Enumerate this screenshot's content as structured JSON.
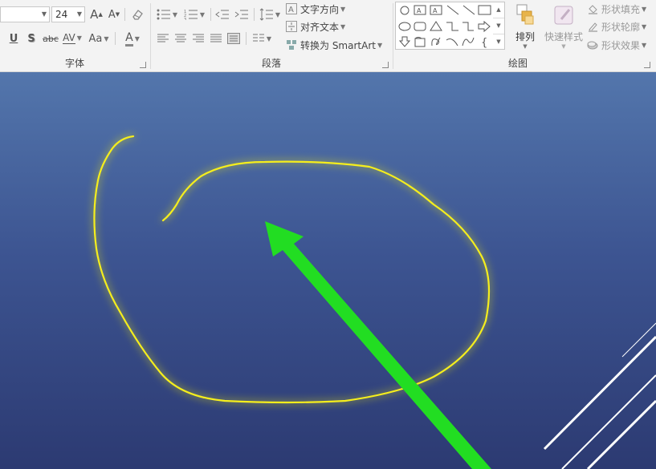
{
  "ribbon": {
    "font_group": {
      "label": "字体",
      "font_name_value": "",
      "font_size_value": "24",
      "grow_font": "A",
      "shrink_font": "A",
      "underline": "U",
      "shadow": "S",
      "strikethrough": "abc",
      "char_spacing": "AV",
      "change_case": "Aa",
      "font_color": "A"
    },
    "paragraph_group": {
      "label": "段落",
      "text_direction": "文字方向",
      "align_text": "对齐文本",
      "convert_smartart": "转换为 SmartArt"
    },
    "drawing_group": {
      "label": "绘图",
      "arrange": "排列",
      "quick_styles": "快速样式",
      "shape_fill": "形状填充",
      "shape_outline": "形状轮廓",
      "shape_effects": "形状效果"
    }
  },
  "colors": {
    "annotation_circle": "#f5ee1e",
    "arrow": "#22dd22",
    "slide_top": "#5376ac",
    "slide_bottom": "#2c3a72"
  }
}
